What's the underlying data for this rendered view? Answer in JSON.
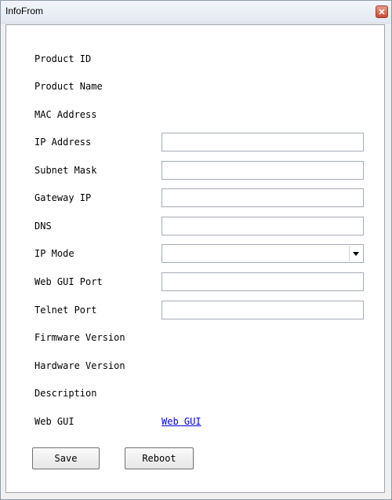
{
  "window": {
    "title": "InfoFrom",
    "close_icon": "close-icon"
  },
  "form": {
    "product_id": {
      "label": "Product ID"
    },
    "product_name": {
      "label": "Product Name"
    },
    "mac_address": {
      "label": "MAC Address"
    },
    "ip_address": {
      "label": "IP Address",
      "value": ""
    },
    "subnet_mask": {
      "label": "Subnet Mask",
      "value": ""
    },
    "gateway_ip": {
      "label": "Gateway IP",
      "value": ""
    },
    "dns": {
      "label": "DNS",
      "value": ""
    },
    "ip_mode": {
      "label": "IP Mode",
      "value": ""
    },
    "web_gui_port": {
      "label": "Web GUI Port",
      "value": ""
    },
    "telnet_port": {
      "label": "Telnet Port",
      "value": ""
    },
    "firmware_version": {
      "label": "Firmware Version"
    },
    "hardware_version": {
      "label": "Hardware Version"
    },
    "description": {
      "label": "Description"
    },
    "web_gui": {
      "label": "Web GUI",
      "link_text": "Web GUI"
    }
  },
  "buttons": {
    "save": "Save",
    "reboot": "Reboot"
  },
  "colors": {
    "link": "#0000ee",
    "close_button": "#c74a33"
  }
}
